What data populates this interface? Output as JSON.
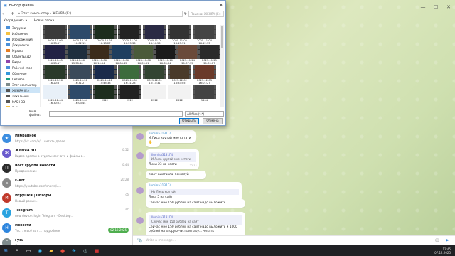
{
  "dialog": {
    "title": "Выбор файла",
    "path": "«  Этот компьютер  ›  ЖЕНЯА (E:)",
    "search_placeholder": "Поиск в: ЖЕНЯА (E:)",
    "toolbar": {
      "organize": "Упорядочить ▾",
      "new_folder": "Новая папка"
    },
    "nav_items": [
      "Загрузки",
      "Избранное",
      "Изображения",
      "Документы",
      "Музыка",
      "Объекты 3D",
      "Видео",
      "Рабочий стол",
      "Облачное",
      "Сетевое",
      "Этот компьютер",
      "ЖЕНЯА (E:)",
      "Локальный",
      "NASH 3D",
      "Библиотеки"
    ],
    "files": [
      "2025-11-00\n16:33:57",
      "2025-10-29\n16:02:13",
      "2025-10-29\n16:13:27",
      "2025-11-03\n16:25:36",
      "2025-11-01\n16:14:56",
      "2025-11-02\n16:15:31",
      "2025-11-04\n16:12:33",
      "2025-11-05\n16:23:17",
      "2025-11-06\n13:38:46",
      "2025-11-06\n10:10:54",
      "2025-11-06\n16:08:45",
      "2025-11-08\n16:09:51",
      "2025-11-10\n16:35:04",
      "2025-11-24\n21:07:35",
      "2025-11-25\n21:09:27",
      "2025-11-26\n16:20:57",
      "2025-11-28\n16:31:27",
      "2025-11-28\n15:45:38",
      "2025-11-30\n16:31:23",
      "2025-12-01\n15:13:31",
      "2025-12-02\n16:33:05",
      "2025-12-03\n16:01:27",
      "2025-12-04\n16:30:23",
      "2025-12-04\n16:03:44",
      "2222",
      "2222",
      "2222",
      "2222",
      "5454"
    ],
    "filename_label": "Имя файла:",
    "filetype": "All files (*.*)",
    "open_label": "Открыть",
    "cancel_label": "Отмена"
  },
  "chats": [
    {
      "name": "Избранное",
      "preview": "https://vk.com/a/...  читать далее",
      "time": "",
      "badge": "",
      "color": "#3d8ee0",
      "icon": "★"
    },
    {
      "name": "ЖЕНЯА 3D",
      "preview": "Видео сделал в отдельном чате и файлы в...",
      "time": "0:52",
      "badge": "",
      "color": "#6a5acd",
      "icon": "Ж"
    },
    {
      "name": "пост группа новости",
      "preview": "Продолжение",
      "time": "0:44",
      "badge": "",
      "color": "#2c2c2c",
      "icon": "П"
    },
    {
      "name": "E-Art",
      "preview": "https://youtube.com/shorts/u...",
      "time": "20:28",
      "badge": "",
      "color": "#888",
      "icon": "E"
    },
    {
      "name": "Игрушки | Обзоры",
      "preview": "Новый ролик…",
      "time": "сб",
      "badge": "",
      "color": "#c0392b",
      "icon": "И"
    },
    {
      "name": "Telegram",
      "preview": "new device: login Telegram · Desktop...",
      "time": "вт",
      "badge": "",
      "color": "#2aa3e0",
      "icon": "T"
    },
    {
      "name": "Новости",
      "preview": "Тест: я всё вот ... подробнее",
      "time": "",
      "badge": "02.12.2025",
      "color": "#2e86de",
      "icon": "Н"
    },
    {
      "name": "Гусь",
      "preview": "Да",
      "time": "",
      "badge": "",
      "color": "#7f8c8d",
      "icon": "Г"
    }
  ],
  "messages": [
    {
      "name": "Ilumina3131Г4",
      "text": "И Лиса крутой мне кстати",
      "time": ""
    },
    {
      "name": "",
      "text": "🖐 ",
      "time": ""
    },
    {
      "quote_name": "Ilumina3131Г4",
      "quote": "И Лиса крутой мне кстати",
      "text": "Лисы 23 на части",
      "time": "22:11"
    },
    {
      "name": "",
      "text": "я вот выставлю пожалуй",
      "time": ""
    },
    {
      "name": "Ilumina3131Г4",
      "quote": "Ну Лисы крутой",
      "text": "Лиса 5 на сайт",
      "time": ""
    },
    {
      "name": "",
      "text": "Сейчас мне 150 рублей на сайт надо выложить",
      "time": ""
    },
    {
      "quote_name": "Ilumina3131Г4",
      "quote": "Сейчас мне 150 рублей на сайт",
      "text": "Сейчас мне 150 рублей на сайт надо выложить и 1000 рублей на вторую часть и пару... читать",
      "time": ""
    }
  ],
  "input": {
    "placeholder": "Write a message..."
  },
  "taskbar": {
    "time": "12:45",
    "date": "07.12.2025"
  }
}
